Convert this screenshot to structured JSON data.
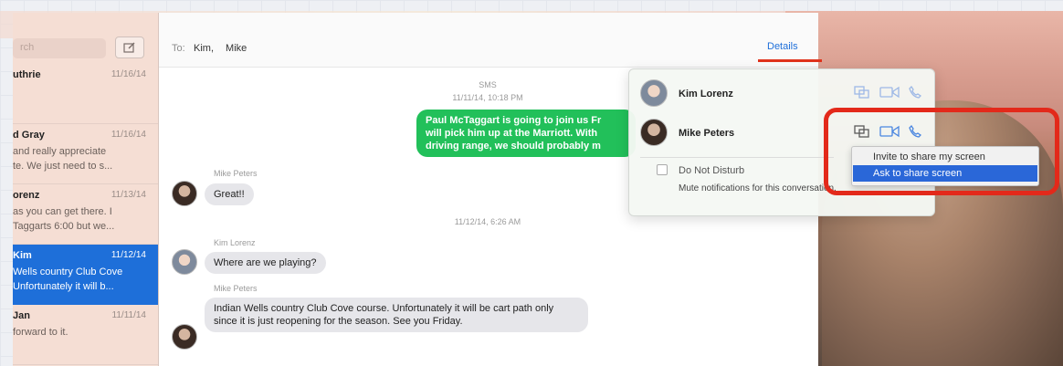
{
  "sidebar": {
    "search_placeholder": "rch",
    "conversations": [
      {
        "name": "uthrie",
        "date": "11/16/14",
        "preview": ""
      },
      {
        "name": "d Gray",
        "date": "11/16/14",
        "preview": "and really appreciate\nte.  We just need to s..."
      },
      {
        "name": "orenz",
        "date": "11/13/14",
        "preview": "as you can get there. I\nTaggarts 6:00 but we..."
      },
      {
        "name": "Kim",
        "date": "11/12/14",
        "preview": "Wells country Club Cove\nUnfortunately it will b..."
      },
      {
        "name": "Jan",
        "date": "11/11/14",
        "preview": "forward to it."
      }
    ]
  },
  "chat": {
    "to_label": "To:",
    "to_names": "Kim,  Mike",
    "details_label": "Details",
    "sms_label": "SMS",
    "timestamp_1": "11/11/14, 10:18 PM",
    "green_message": "Paul McTaggart is going to join us Fr\nwill pick him up at the Marriott. With\ndriving range, we should probably m",
    "sender_mike_1": "Mike Peters",
    "reply_great": "Great!!",
    "timestamp_2": "11/12/14, 6:26 AM",
    "sender_kim": "Kim Lorenz",
    "reply_where": "Where are we playing?",
    "sender_mike_2": "Mike Peters",
    "reply_course": "Indian Wells country Club Cove course. Unfortunately it will be cart path only since it is just reopening for the season. See you Friday."
  },
  "details": {
    "participants": [
      {
        "name": "Kim Lorenz"
      },
      {
        "name": "Mike Peters"
      }
    ],
    "dnd_label": "Do Not Disturb",
    "mute_text": "Mute notifications for this conversation."
  },
  "menu": {
    "items": [
      "Invite to share my screen",
      "Ask to share screen"
    ],
    "highlighted": "Ask to share screen"
  },
  "colors": {
    "accent": "#1e6fd9",
    "sms_bubble": "#22c05a",
    "annotation": "#e3291a",
    "menu_highlight": "#2a67d8"
  }
}
